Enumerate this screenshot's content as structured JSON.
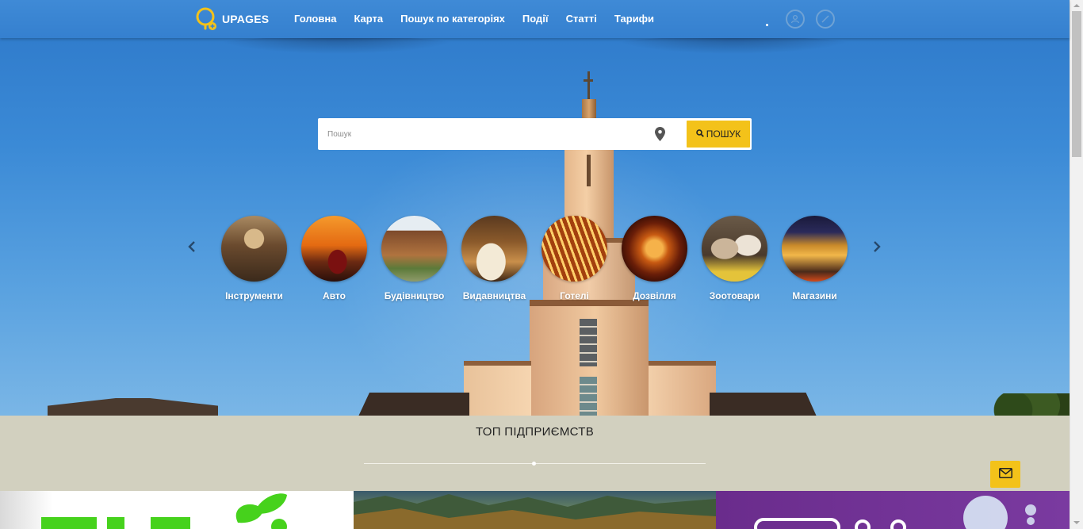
{
  "brand": {
    "name": "UPAGES",
    "logo_color": "#f3c21a"
  },
  "nav": {
    "items": [
      {
        "label": "Головна"
      },
      {
        "label": "Карта"
      },
      {
        "label": "Пошук по категоріях"
      },
      {
        "label": "Події"
      },
      {
        "label": "Статті"
      },
      {
        "label": "Тарифи"
      }
    ]
  },
  "header_icons": [
    "user-icon",
    "compass-icon"
  ],
  "search": {
    "placeholder": "Пошук",
    "value": "",
    "location_icon": "map-pin-icon",
    "button_label": "ПОШУК",
    "button_icon": "search-icon",
    "button_color": "#f3c21a"
  },
  "categories": {
    "prev_icon": "chevron-left-icon",
    "next_icon": "chevron-right-icon",
    "items": [
      {
        "label": "Інструменти"
      },
      {
        "label": "Авто"
      },
      {
        "label": "Будівництво"
      },
      {
        "label": "Видавництва"
      },
      {
        "label": "Готелі"
      },
      {
        "label": "Дозвілля"
      },
      {
        "label": "Зоотовари"
      },
      {
        "label": "Магазини"
      }
    ]
  },
  "top_section": {
    "title": "ТОП ПІДПРИЄМСТВ",
    "background": "#d2d0bf"
  },
  "contact_button_icon": "envelope-icon"
}
